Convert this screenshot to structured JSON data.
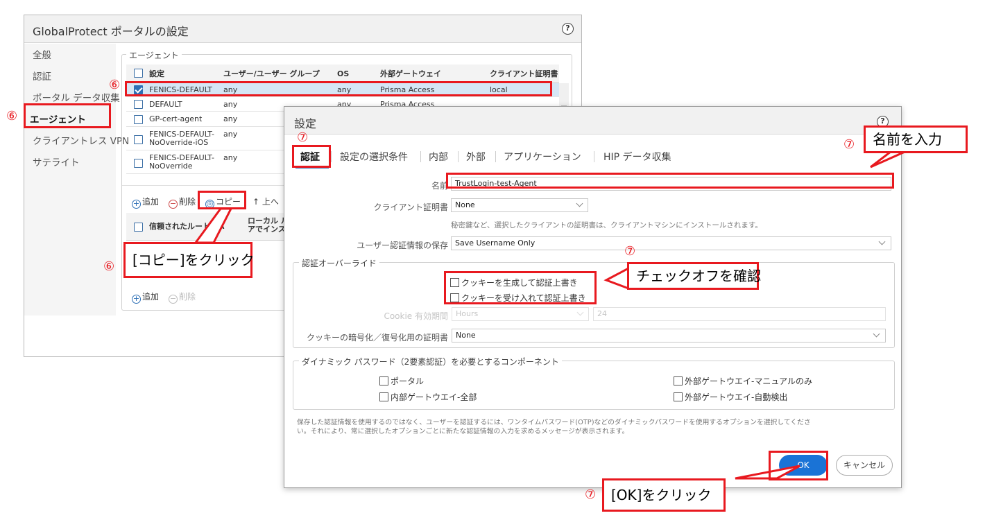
{
  "back_window": {
    "title": "GlobalProtect ポータルの設定",
    "help": "?",
    "sidebar": [
      "全般",
      "認証",
      "ポータル データ収集",
      "エージェント",
      "クライアントレス VPN",
      "サテライト"
    ],
    "agent_legend": "エージェント",
    "columns": [
      "設定",
      "ユーザー/ユーザー グループ",
      "OS",
      "外部ゲートウェイ",
      "クライアント証明書"
    ],
    "rows": [
      {
        "name": "FENICS-DEFAULT",
        "user": "any",
        "os": "any",
        "gateway": "Prisma Access",
        "cert": "local"
      },
      {
        "name": "DEFAULT",
        "user": "any",
        "os": "any",
        "gateway": "Prisma Access",
        "cert": ""
      },
      {
        "name": "GP-cert-agent",
        "user": "any",
        "os": "",
        "gateway": "",
        "cert": ""
      },
      {
        "name": "FENICS-DEFAULT-\nNoOverride-iOS",
        "user": "any",
        "os": "",
        "gateway": "",
        "cert": ""
      },
      {
        "name": "FENICS-DEFAULT-\nNoOverride",
        "user": "any",
        "os": "",
        "gateway": "",
        "cert": ""
      }
    ],
    "toolbar": {
      "add": "追加",
      "delete": "削除",
      "copy": "コピー",
      "up": "上へ"
    },
    "ca_table": {
      "col1": "信頼されたルート CA",
      "col2": "ローカル ルート\nアでインストール"
    },
    "toolbar2": {
      "add": "追加",
      "delete": "削除"
    }
  },
  "dialog": {
    "title": "設定",
    "help": "?",
    "tabs": [
      "認証",
      "設定の選択条件",
      "内部",
      "外部",
      "アプリケーション",
      "HIP データ収集"
    ],
    "name_label": "名前",
    "name_value": "TrustLogin-test-Agent",
    "client_cert_label": "クライアント証明書",
    "client_cert_value": "None",
    "client_cert_hint": "秘密鍵など、選択したクライアントの証明書は、クライアントマシンにインストールされます。",
    "save_cred_label": "ユーザー認証情報の保存",
    "save_cred_value": "Save Username Only",
    "override_legend": "認証オーバーライド",
    "cookie_generate": "クッキーを生成して認証上書き",
    "cookie_accept": "クッキーを受け入れて認証上書き",
    "cookie_lifetime_label": "Cookie 有効期間",
    "cookie_lifetime_unit": "Hours",
    "cookie_lifetime_value": "24",
    "cookie_cert_label": "クッキーの暗号化／復号化用の証明書",
    "cookie_cert_value": "None",
    "dynamic_legend": "ダイナミック パスワード（2要素認証）を必要とするコンポーネント",
    "dyn_portal": "ポータル",
    "dyn_internal_all": "内部ゲートウエイ-全部",
    "dyn_external_manual": "外部ゲートウエイ-マニュアルのみ",
    "dyn_external_auto": "外部ゲートウエイ-自動検出",
    "footer_note_1": "保存した認証情報を使用するのではなく、ユーザーを認証するには、ワンタイムパスワード(OTP)などのダイナミックパスワードを使用するオプションを選択してくださ",
    "footer_note_2": "い。それにより、常に選択したオプションごとに新たな認証情報の入力を求めるメッセージが表示されます。",
    "ok": "OK",
    "cancel": "キャンセル"
  },
  "annotations": {
    "step6": "⑥",
    "step7": "⑦",
    "copy_click": "[コピー]をクリック",
    "enter_name": "名前を入力",
    "check_off": "チェックオフを確認",
    "ok_click": "[OK]をクリック",
    "color": "#e8191f"
  }
}
